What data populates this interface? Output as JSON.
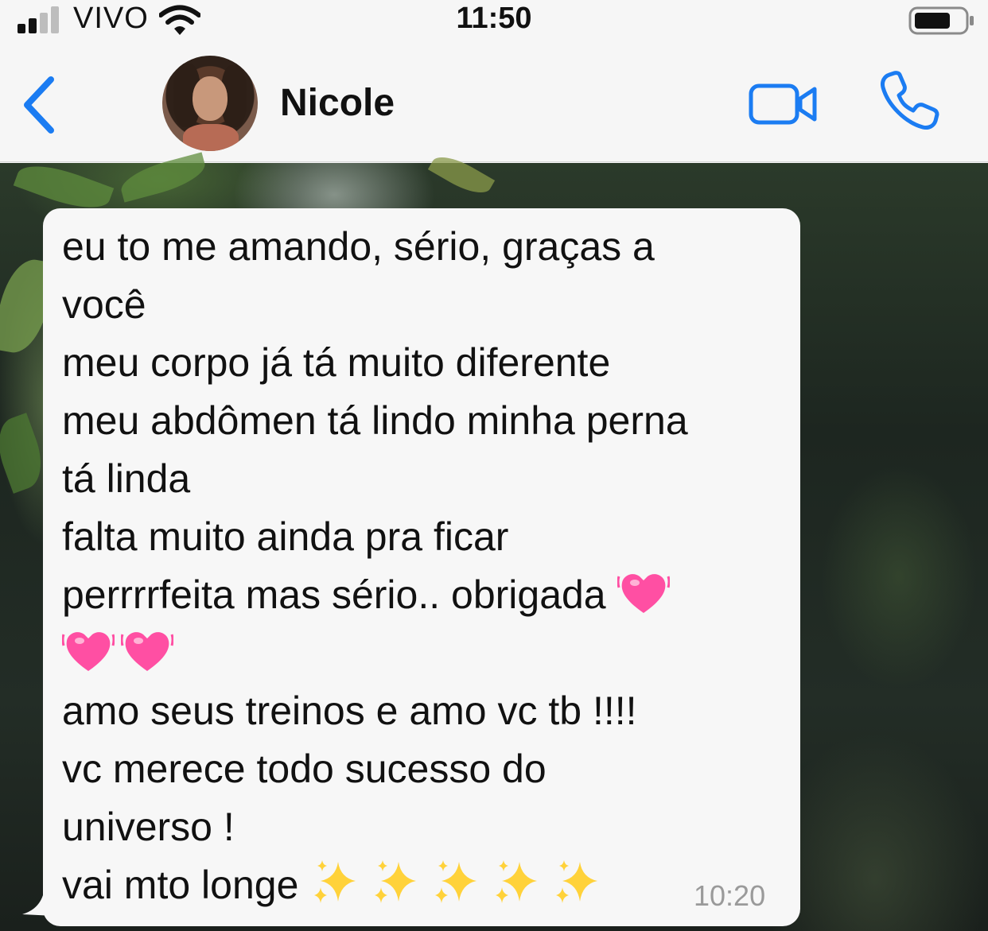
{
  "status_bar": {
    "carrier": "VIVO",
    "time": "11:50",
    "signal_bars": 2,
    "signal_icon": "signal-icon",
    "wifi_icon": "wifi-icon",
    "battery_icon": "battery-icon"
  },
  "header": {
    "contact_name": "Nicole",
    "back_icon": "chevron-left-icon",
    "video_icon": "video-camera-icon",
    "call_icon": "phone-icon",
    "accent_color": "#1b7cf2"
  },
  "message": {
    "lines": [
      "eu to me amando, sério, graças a",
      "você",
      "meu corpo já tá muito diferente",
      "meu abdômen tá lindo minha perna",
      "tá linda",
      "falta muito ainda pra ficar",
      "perrrrfeita mas sério.. obrigada",
      "",
      "amo seus treinos e amo vc tb !!!!",
      "vc merece todo sucesso do",
      "universo !",
      "vai mto longe"
    ],
    "emoji": {
      "heart": "💓",
      "sparkles": "✨"
    },
    "time": "10:20",
    "bubble_color": "#f7f7f7"
  }
}
